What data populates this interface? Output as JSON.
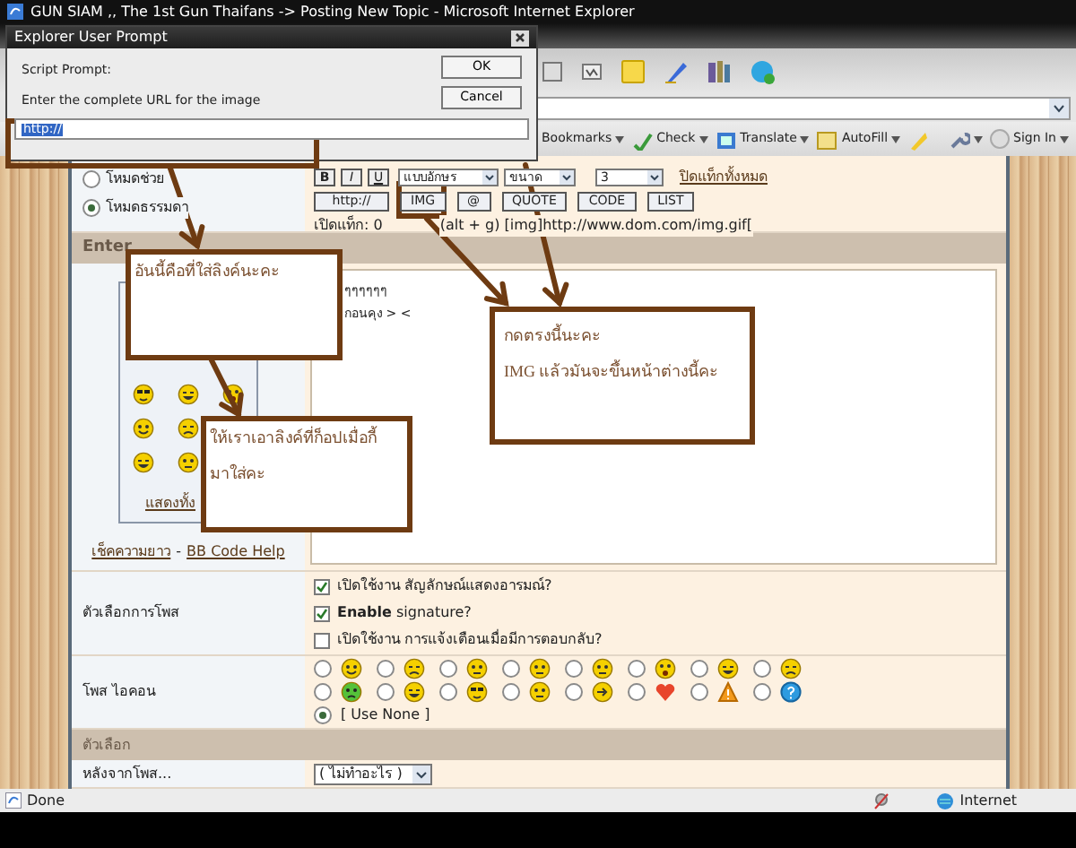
{
  "browser": {
    "title": "GUN SIAM ,, The 1st Gun Thaifans -> Posting New Topic - Microsoft Internet Explorer",
    "toolbar": [
      {
        "label": "Bookmarks"
      },
      {
        "label": "Check"
      },
      {
        "label": "Translate"
      },
      {
        "label": "AutoFill"
      }
    ],
    "sign_in": "Sign In",
    "status": "Done",
    "zone": "Internet"
  },
  "dialog": {
    "title": "Explorer User Prompt",
    "label": "Script Prompt:",
    "message": "Enter the complete URL for the image",
    "value": "http://",
    "buttons": [
      "OK",
      "Cancel"
    ]
  },
  "editor": {
    "modes": [
      {
        "label": "โหมดช่วย",
        "selected": false
      },
      {
        "label": "โหมดธรรมดา",
        "selected": true
      }
    ],
    "format_buttons": [
      "B",
      "I",
      "U"
    ],
    "selects": [
      "แบบอักษร",
      "ขนาด",
      "3"
    ],
    "close_tags": "ปิดแท็กทั้งหมด",
    "tag_buttons": [
      "http://",
      "IMG",
      "@",
      "QUOTE",
      "CODE",
      "LIST"
    ],
    "open_tags": "เปิดแท็ก: 0",
    "hint": "(alt + g) [img]http://www.dom.com/img.gif[",
    "section": "Enter",
    "body_lines": [
      "ๆๆๆๆๆๆ",
      "กอนคุง > <"
    ],
    "show_all": "แสดงทั้ง",
    "links": [
      "เช็คความยาว",
      "BB Code Help"
    ],
    "link_separator": "-"
  },
  "post_options": {
    "label": "ตัวเลือกการโพส",
    "items": [
      {
        "text": "เปิดใช้งาน สัญลักษณ์แสดงอารมณ์?",
        "checked": true
      },
      {
        "text": "**Enable** signature?",
        "checked": true
      },
      {
        "text": "เปิดใช้งาน การแจ้งเตือนเมื่อมีการตอบกลับ?",
        "checked": false
      }
    ]
  },
  "post_icons": {
    "label": "โพส ไอคอน",
    "icons": [
      {
        "selected": false
      },
      {
        "selected": false
      },
      {
        "selected": false
      },
      {
        "selected": false
      },
      {
        "selected": false
      },
      {
        "selected": false
      },
      {
        "selected": false
      },
      {
        "selected": false
      },
      {
        "selected": false
      },
      {
        "selected": false
      },
      {
        "selected": false
      },
      {
        "selected": false
      },
      {
        "selected": false
      },
      {
        "selected": false
      },
      {
        "selected": false
      },
      {
        "selected": false
      }
    ],
    "none": {
      "label": "[ Use None ]",
      "selected": true
    }
  },
  "options_header": "ตัวเลือก",
  "after_post": {
    "label": "หลังจากโพส...",
    "value": "( ไม่ทำอะไร )"
  },
  "annotations": [
    {
      "lines": [
        "อันนี้คือที่ใส่ลิงค์นะคะ"
      ]
    },
    {
      "lines": [
        "ให้เราเอาลิงค์ที่ก็อปเมื่อกี้",
        "มาใส่คะ"
      ]
    },
    {
      "lines": [
        "กดตรงนี้นะคะ",
        "IMG แล้วมันจะขึ้นหน้าต่างนี้คะ"
      ]
    }
  ]
}
